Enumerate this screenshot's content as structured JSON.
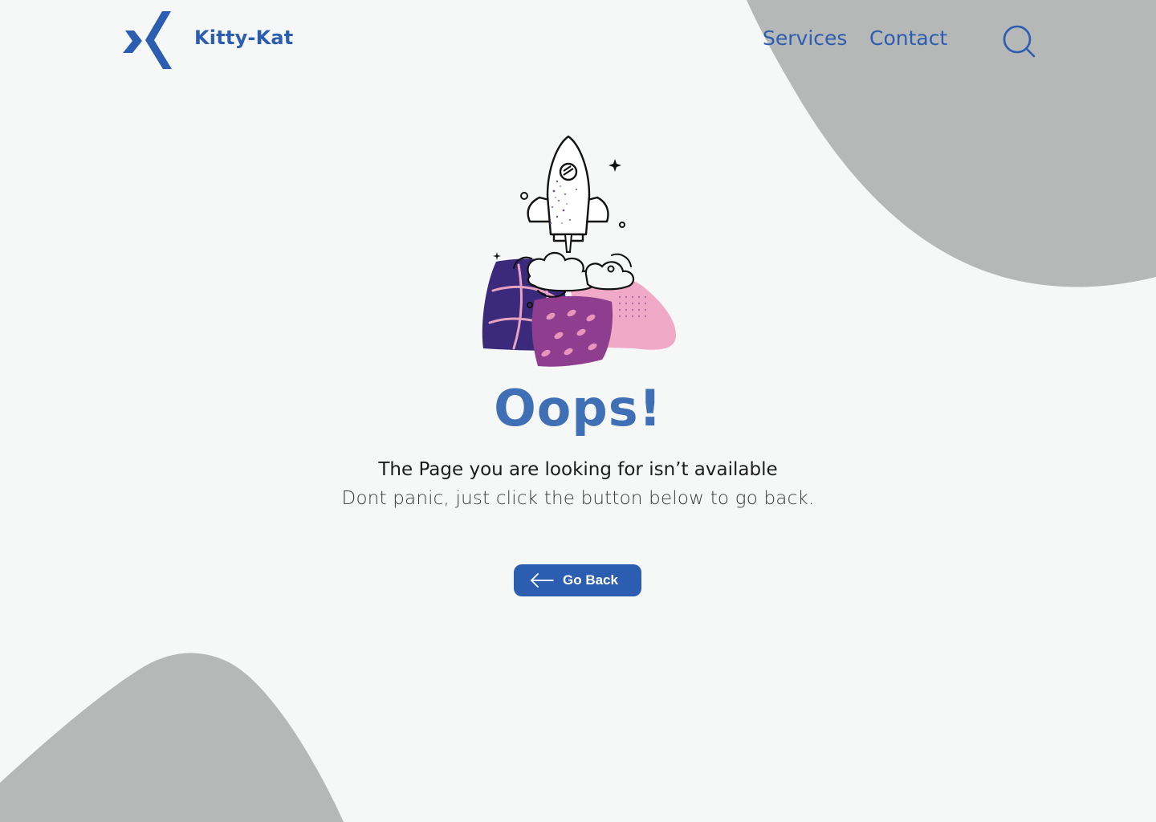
{
  "brand": {
    "name": "Kitty-Kat",
    "logo_icon": "x-chevron-logo-icon",
    "color": "#2b5db0"
  },
  "nav": {
    "items": [
      {
        "label": "Services"
      },
      {
        "label": "Contact"
      }
    ],
    "search_icon": "search-icon"
  },
  "error": {
    "illustration_icon": "rocket-launch-illustration",
    "title": "Oops!",
    "subtitle": "The Page you are looking for isn’t available",
    "description": "Dont panic, just click the button below to go back."
  },
  "actions": {
    "go_back_label": "Go Back",
    "go_back_icon": "arrow-left-icon"
  },
  "colors": {
    "background": "#f6f8f7",
    "blob": "#b6b8b7",
    "primary": "#2b5db0",
    "title": "#3f6fb4"
  }
}
